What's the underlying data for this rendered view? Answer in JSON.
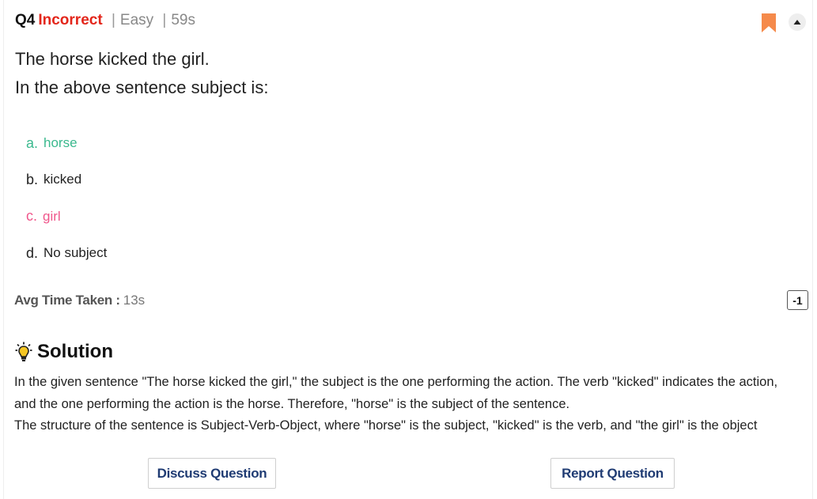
{
  "question": {
    "number": "Q4",
    "status": "Incorrect",
    "separator": "|",
    "difficulty": "Easy",
    "time": "59s",
    "lines": [
      "The horse kicked the girl.",
      "In the above sentence subject is:"
    ]
  },
  "options": [
    {
      "letter": "a.",
      "text": "horse",
      "state": "correct"
    },
    {
      "letter": "b.",
      "text": "kicked",
      "state": "normal"
    },
    {
      "letter": "c.",
      "text": "girl",
      "state": "wrong"
    },
    {
      "letter": "d.",
      "text": "No subject",
      "state": "normal"
    }
  ],
  "stats": {
    "avg_label": "Avg Time Taken :",
    "avg_value": "13s",
    "score": "-1"
  },
  "solution": {
    "title": "Solution",
    "lines": [
      "In the given sentence \"The horse kicked the girl,\" the subject is the one performing the action. The verb \"kicked\" indicates the action,",
      "and the one performing the action is the horse. Therefore, \"horse\" is the subject of the sentence.",
      "The structure of the sentence is Subject-Verb-Object, where \"horse\" is the subject, \"kicked\" is the verb, and \"the girl\" is the object"
    ]
  },
  "buttons": {
    "discuss": "Discuss Question",
    "report": "Report Question"
  },
  "icons": {
    "bookmark": "bookmark-icon",
    "collapse": "chevron-up-icon",
    "solution": "lightbulb-icon"
  },
  "colors": {
    "incorrect": "#e3261b",
    "correct_option": "#3bb98e",
    "wrong_option": "#f0568b",
    "bookmark": "#f58a4b",
    "button_text": "#1f3b73"
  }
}
